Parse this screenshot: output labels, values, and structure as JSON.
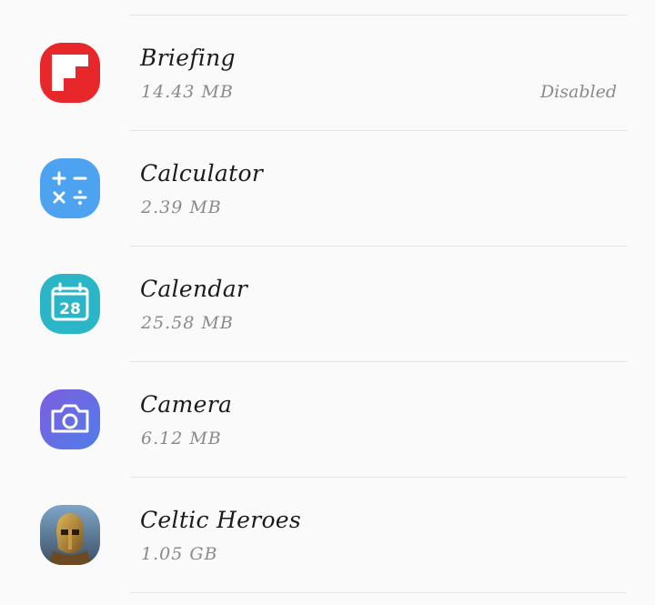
{
  "apps": [
    {
      "name": "Briefing",
      "size": "14.43 MB",
      "status": "Disabled",
      "icon": "flipboard-icon",
      "color": "#e8272b"
    },
    {
      "name": "Calculator",
      "size": "2.39 MB",
      "status": "",
      "icon": "calculator-icon",
      "color": "#4ea3f0"
    },
    {
      "name": "Calendar",
      "size": "25.58 MB",
      "status": "",
      "icon": "calendar-icon",
      "color": "#2bb6c8",
      "icon_text": "28"
    },
    {
      "name": "Camera",
      "size": "6.12 MB",
      "status": "",
      "icon": "camera-icon",
      "color": "#6b6fe0"
    },
    {
      "name": "Celtic Heroes",
      "size": "1.05 GB",
      "status": "",
      "icon": "celtic-heroes-icon",
      "color": "#8a6b3a"
    }
  ]
}
